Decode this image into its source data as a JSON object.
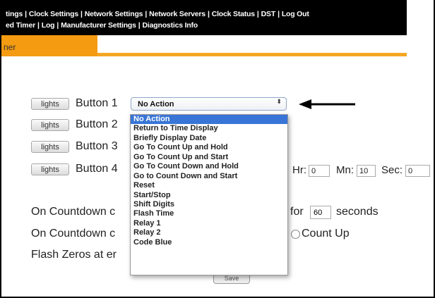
{
  "nav": {
    "line1": [
      "tings",
      "Clock Settings",
      "Network Settings",
      "Network Servers",
      "Clock Status",
      "DST",
      "Log Out"
    ],
    "line2": [
      "ed Timer",
      "Log",
      "Manufacturer Settings",
      "Diagnostics Info"
    ]
  },
  "orange_tab": {
    "label": "ner"
  },
  "buttons": [
    {
      "lights_label": "lights",
      "label": "Button 1"
    },
    {
      "lights_label": "lights",
      "label": "Button 2"
    },
    {
      "lights_label": "lights",
      "label": "Button 3"
    },
    {
      "lights_label": "lights",
      "label": "Button 4"
    }
  ],
  "select": {
    "value": "No Action",
    "arrows": "⬍"
  },
  "dropdown": {
    "selected_index": 0,
    "options": [
      "No Action",
      "Return to Time Display",
      "Briefly Display Date",
      "Go To Count Up and Hold",
      "Go To Count Up and Start",
      "Go To Count Down and Hold",
      "Go to Count Down and Start",
      "Reset",
      "Start/Stop",
      "Shift Digits",
      "Flash Time",
      "Relay 1",
      "Relay 2",
      "Code Blue"
    ]
  },
  "time": {
    "hr_label": "Hr:",
    "hr_value": "0",
    "mn_label": "Mn:",
    "mn_value": "10",
    "sec_label": "Sec:",
    "sec_value": "0"
  },
  "countdown": {
    "line1": "On Countdown c",
    "for_label": "for",
    "seconds_value": "60",
    "seconds_label": "seconds",
    "line2": "On Countdown c",
    "count_up_label": "Count Up",
    "line3": "Flash Zeros at er"
  },
  "save": {
    "label": "Save"
  },
  "colors": {
    "nav_bg": "#000000",
    "orange": "#f5a623",
    "highlight": "#3875d7"
  }
}
